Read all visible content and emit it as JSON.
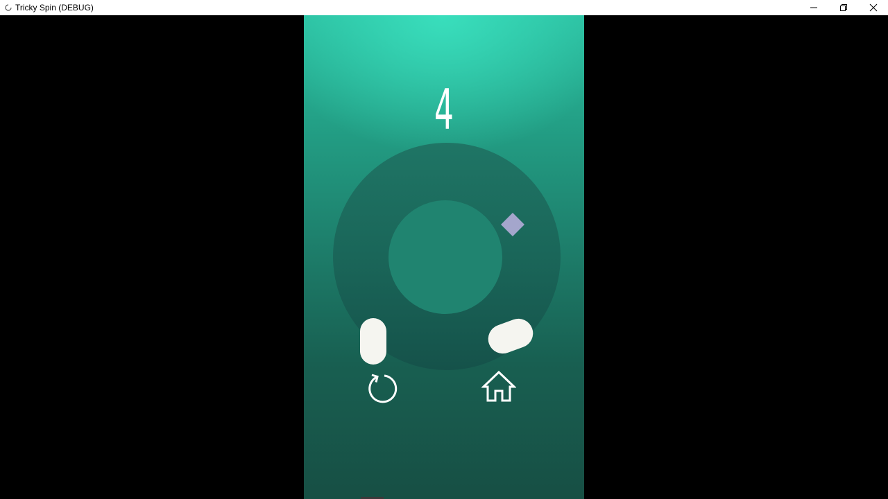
{
  "window": {
    "title": "Tricky Spin (DEBUG)",
    "icon": "app-loading-icon",
    "controls": [
      "minimize-icon",
      "restore-icon",
      "close-icon"
    ]
  },
  "game": {
    "score": "4",
    "buttons": {
      "restart_icon": "restart-icon",
      "home_icon": "home-icon"
    },
    "colors": {
      "top_glow": "#3ae0be",
      "background_bottom": "#174f44",
      "ring": "#1a6659",
      "inner_circle": "#208470",
      "gem": "#a4a6cc",
      "paddle": "#f5f5f0"
    }
  }
}
